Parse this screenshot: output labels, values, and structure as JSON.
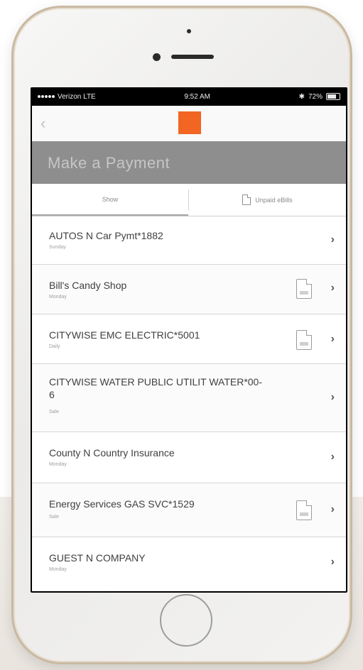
{
  "status_bar": {
    "carrier": "Verizon LTE",
    "time": "9:52 AM",
    "battery": "72%"
  },
  "header": {
    "back_icon": "chevron-left-icon",
    "logo_color": "#f26522",
    "title": "Make a Payment"
  },
  "tabs": [
    {
      "label": "Show"
    },
    {
      "label": "Unpaid eBills",
      "icon": "document-icon"
    }
  ],
  "payees": [
    {
      "name": "AUTOS N Car Pymt*1882",
      "sub": "Sunday",
      "ebill": false
    },
    {
      "name": "Bill's Candy Shop",
      "sub": "Monday",
      "ebill": true
    },
    {
      "name": "CITYWISE EMC ELECTRIC*5001",
      "sub": "Daily",
      "ebill": true
    },
    {
      "name": "CITYWISE WATER PUBLIC UTILIT WATER*00-6",
      "sub": "Sale",
      "ebill": false
    },
    {
      "name": "County N Country Insurance",
      "sub": "Monday",
      "ebill": false
    },
    {
      "name": "Energy Services GAS SVC*1529",
      "sub": "Sale",
      "ebill": true
    },
    {
      "name": "GUEST N COMPANY",
      "sub": "Monday",
      "ebill": false
    }
  ],
  "colors": {
    "brand": "#f26522",
    "title_band": "#8e8e8e"
  }
}
